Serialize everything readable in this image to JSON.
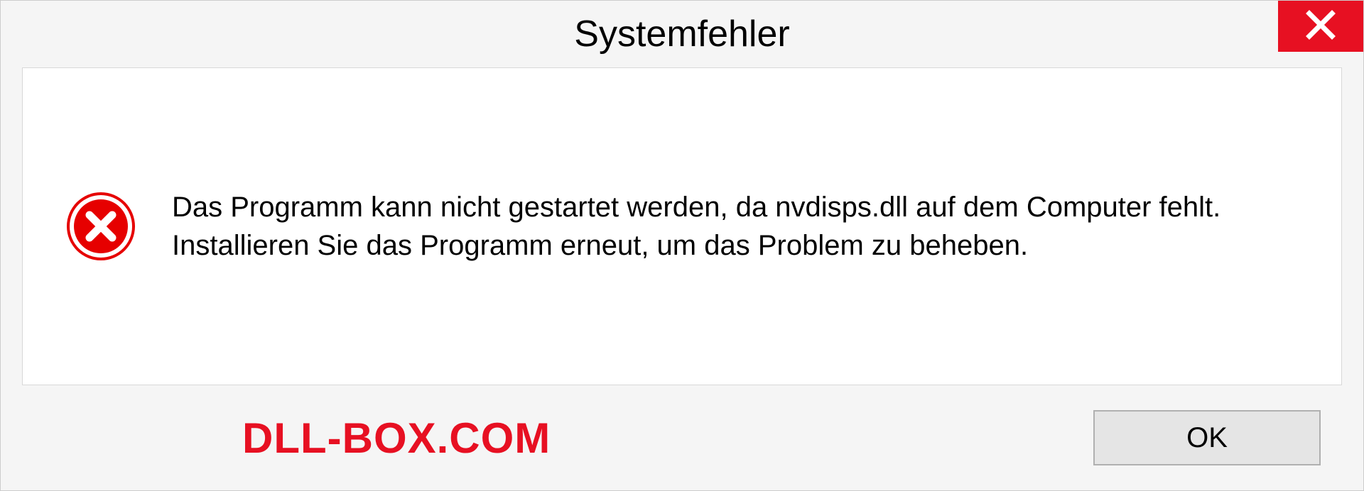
{
  "dialog": {
    "title": "Systemfehler",
    "message": "Das Programm kann nicht gestartet werden, da nvdisps.dll auf dem Computer fehlt. Installieren Sie das Programm erneut, um das Problem zu beheben.",
    "ok_label": "OK"
  },
  "watermark": "DLL-BOX.COM",
  "colors": {
    "error_red": "#e71022",
    "close_red": "#e71022"
  }
}
